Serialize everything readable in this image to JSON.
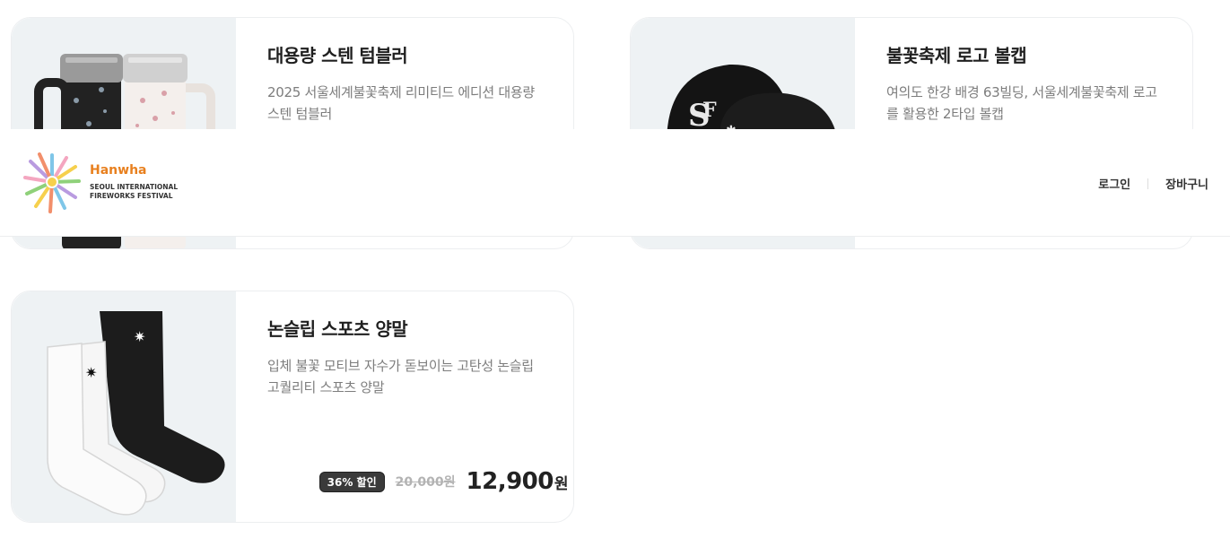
{
  "header": {
    "logo": {
      "brand": "Hanwha",
      "line1": "SEOUL INTERNATIONAL",
      "line2": "FIREWORKS FESTIVAL"
    },
    "nav": {
      "login": "로그인",
      "cart": "장바구니"
    }
  },
  "products": [
    {
      "title": "대용량 스텐 텀블러",
      "desc": "2025 서울세계불꽃축제 리미티드 에디션 대용량 스텐 텀블러",
      "image": "tumbler-image"
    },
    {
      "title": "불꽃축제 로고 볼캡",
      "desc": "여의도 한강 배경 63빌딩, 서울세계불꽃축제 로고를 활용한 2타입 볼캡",
      "image": "ballcap-image"
    },
    {
      "title": "논슬립 스포츠 양말",
      "desc": "입체 불꽃 모티브 자수가 돋보이는 고탄성 논슬립 고퀄리티 스포츠 양말",
      "image": "socks-image",
      "discount_badge": "36% 할인",
      "original_price": "20,000원",
      "price": "12,900",
      "currency": "원"
    }
  ],
  "colors": {
    "brand": "#e8801f",
    "thumb_bg": "#eef2f4",
    "badge_bg": "#3a3a3a"
  }
}
